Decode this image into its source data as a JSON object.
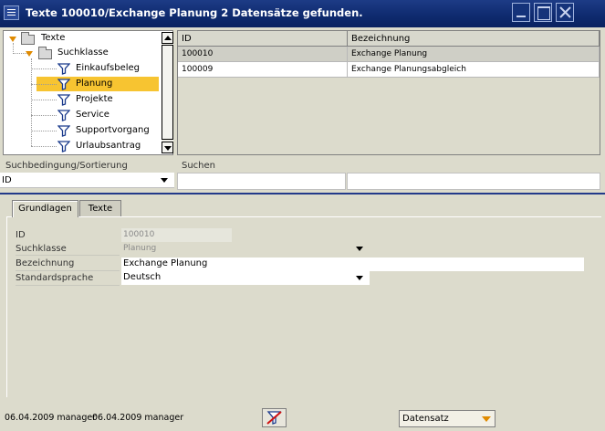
{
  "window": {
    "title": "Texte 100010/Exchange Planung  2 Datensätze gefunden."
  },
  "tree": {
    "root": "Texte",
    "group": "Suchklasse",
    "items": [
      "Einkaufsbeleg",
      "Planung",
      "Projekte",
      "Service",
      "Supportvorgang",
      "Urlaubsantrag"
    ],
    "selected": "Planung"
  },
  "grid": {
    "columns": [
      "ID",
      "Bezeichnung"
    ],
    "rows": [
      {
        "id": "100010",
        "bezeichnung": "Exchange Planung"
      },
      {
        "id": "100009",
        "bezeichnung": "Exchange Planungsabgleich"
      }
    ]
  },
  "search": {
    "condition_label": "Suchbedingung/Sortierung",
    "condition_value": "ID",
    "search_label": "Suchen"
  },
  "tabs": [
    "Grundlagen",
    "Texte"
  ],
  "form": {
    "id_label": "ID",
    "id_value": "100010",
    "suchklasse_label": "Suchklasse",
    "suchklasse_value": "Planung",
    "bezeichnung_label": "Bezeichnung",
    "bezeichnung_value": "Exchange Planung",
    "sprache_label": "Standardsprache",
    "sprache_value": "Deutsch"
  },
  "footer": {
    "created": "06.04.2009 manager",
    "modified": "06.04.2009 manager",
    "datensatz_label": "Datensatz"
  },
  "colors": {
    "titlebar": "#0e2a6e",
    "selection": "#f7c431",
    "separator": "#233a8a",
    "background": "#dcdbcc"
  }
}
